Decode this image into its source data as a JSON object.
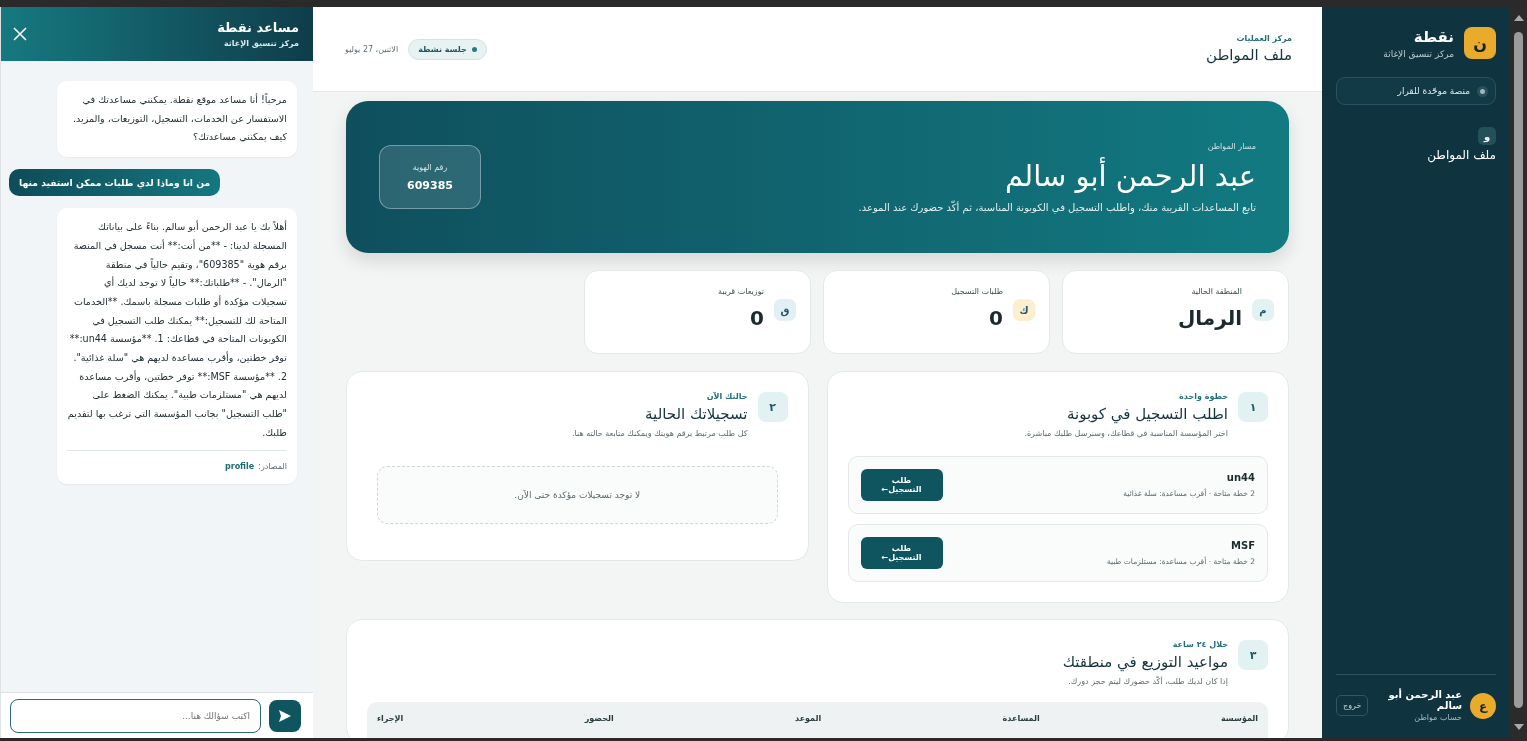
{
  "sidebar": {
    "logo_letter": "ن",
    "title": "نقطة",
    "subtitle": "مركز تنسيق الإغاثة",
    "platform_pill": "منصة موحّدة للقرار",
    "nav_items": [
      {
        "letter": "و",
        "label": "ملف المواطن"
      }
    ],
    "user": {
      "avatar_letter": "ع",
      "name": "عبد الرحمن أبو سالم",
      "role": "حساب مواطن",
      "logout": "خروج"
    }
  },
  "header": {
    "kicker": "مركز العمليات",
    "title": "ملف المواطن",
    "session_badge": "جلسة نشطة",
    "date": "الاثنين، 27 يوليو"
  },
  "hero": {
    "kicker": "مسار المواطن",
    "name": "عبد الرحمن أبو سالم",
    "description": "تابع المساعدات القريبة منك، واطلب التسجيل في الكوبونة المناسبة، ثم أكّد حضورك عند الموعد.",
    "id_label": "رقم الهوية",
    "id_value": "609385"
  },
  "stats": [
    {
      "letter": "م",
      "color": "#e2f1f2",
      "label": "المنطقة الحالية",
      "value": "الرمال"
    },
    {
      "letter": "ك",
      "color": "#fbefcf",
      "label": "طلبات التسجيل",
      "value": "0"
    },
    {
      "letter": "ق",
      "color": "#e2eff4",
      "label": "توزيعات قريبة",
      "value": "0"
    }
  ],
  "register_card": {
    "step": "١",
    "kicker": "خطوة واحدة",
    "title": "اطلب التسجيل في كوبونة",
    "description": "اختر المؤسسة المناسبة في قطاعك، وسنرسل طلبك مباشرة.",
    "organizations": [
      {
        "name": "un44",
        "detail": "2 خطة متاحة · أقرب مساعدة: سلة غذائية",
        "button": "طلب التسجيل←"
      },
      {
        "name": "MSF",
        "detail": "2 خطة متاحة · أقرب مساعدة: مستلزمات طبية",
        "button": "طلب التسجيل←"
      }
    ]
  },
  "status_card": {
    "step": "٢",
    "kicker": "حالتك الآن",
    "title": "تسجيلاتك الحالية",
    "description": "كل طلب مرتبط برقم هويتك ويمكنك متابعة حالته هنا.",
    "empty_text": "لا توجد تسجيلات مؤكدة حتى الآن."
  },
  "schedule_card": {
    "step": "٣",
    "kicker": "خلال ٢٤ ساعة",
    "title": "مواعيد التوزيع في منطقتك",
    "description": "إذا كان لديك طلب، أكّد حضورك ليتم حجز دورك.",
    "table": {
      "columns": [
        "المؤسسة",
        "المساعدة",
        "الموعد",
        "الحضور",
        "الإجراء"
      ]
    }
  },
  "chat": {
    "title": "مساعد نقطة",
    "subtitle": "مركز تنسيق الإغاثة",
    "messages": [
      {
        "kind": "bot",
        "text": "مرحباً! أنا مساعد موقع نقطة. يمكنني مساعدتك في الاستفسار عن الخدمات، التسجيل، التوزيعات، والمزيد. كيف يمكنني مساعدتك؟"
      },
      {
        "kind": "user",
        "text": "من انا وماذا لدي طلبات ممكن استفيد منها"
      },
      {
        "kind": "bot",
        "text": "أهلاً بك يا عبد الرحمن أبو سالم. بناءً على بياناتك المسجلة لدينا: - **من أنت:** أنت مسجل في المنصة برقم هوية \"609385\"، وتقيم حالياً في منطقة \"الرمال\". - **طلباتك:** حالياً لا توجد لديك أي تسجيلات مؤكدة أو طلبات مسجلة باسمك. **الخدمات المتاحة لك للتسجيل:** يمكنك طلب التسجيل في الكوبونات المتاحة في قطاعك: 1. **مؤسسة un44:** توفر خطتين، وأقرب مساعدة لديهم هي \"سلة غذائية\". 2. **مؤسسة MSF:** توفر خطتين، وأقرب مساعدة لديهم هي \"مستلزمات طبية\". يمكنك الضغط على \"طلب التسجيل\" بجانب المؤسسة التي ترغب بها لتقديم طلبك.",
        "sources_label": "المصادر:",
        "source_link": "profile"
      }
    ],
    "input_placeholder": "اكتب سؤالك هنا..."
  }
}
